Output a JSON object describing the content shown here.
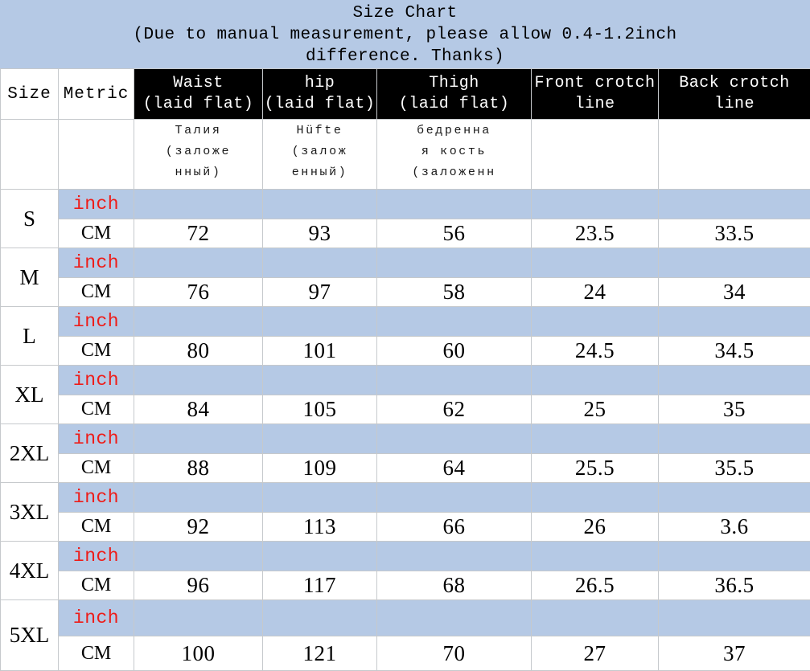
{
  "title": {
    "line1": "Size Chart",
    "line2": "(Due to manual measurement, please allow 0.4-1.2inch",
    "line3": "difference. Thanks)"
  },
  "colors": {
    "banner_blue": "#b5c9e5",
    "stripe_blue": "#b5c9e5",
    "header_black": "#000000",
    "inch_red": "#ee1c18",
    "grid_line": "#c6c9cc"
  },
  "header": {
    "size": "Size",
    "metric": "Metric",
    "waist": {
      "line1": "Waist",
      "line2": "(laid flat)"
    },
    "hip": {
      "line1": "hip",
      "line2": "(laid flat)"
    },
    "thigh": {
      "line1": "Thigh",
      "line2": "(laid flat)"
    },
    "front_crotch": {
      "line1": "Front crotch",
      "line2": "line"
    },
    "back_crotch": {
      "line1": "Back crotch",
      "line2": "line"
    }
  },
  "translations": {
    "waist": {
      "line1": "Талия",
      "line2": "(заложе",
      "line3": "нный)"
    },
    "hip": {
      "line1": "Hüfte",
      "line2": "(залож",
      "line3": "енный)"
    },
    "thigh": {
      "line1": "бедренна",
      "line2": "я кость",
      "line3": "(заложенн"
    }
  },
  "metric_labels": {
    "inch": "inch",
    "cm": "CM"
  },
  "chart_data": {
    "type": "table",
    "title": "Size Chart",
    "columns": [
      "Size",
      "Metric",
      "Waist (laid flat)",
      "hip (laid flat)",
      "Thigh (laid flat)",
      "Front crotch line",
      "Back crotch line"
    ],
    "units": [
      "inch",
      "CM"
    ],
    "rows": [
      {
        "size": "S",
        "inch": {
          "waist": "",
          "hip": "",
          "thigh": "",
          "front_crotch": "",
          "back_crotch": ""
        },
        "cm": {
          "waist": "72",
          "hip": "93",
          "thigh": "56",
          "front_crotch": "23.5",
          "back_crotch": "33.5"
        }
      },
      {
        "size": "M",
        "inch": {
          "waist": "",
          "hip": "",
          "thigh": "",
          "front_crotch": "",
          "back_crotch": ""
        },
        "cm": {
          "waist": "76",
          "hip": "97",
          "thigh": "58",
          "front_crotch": "24",
          "back_crotch": "34"
        }
      },
      {
        "size": "L",
        "inch": {
          "waist": "",
          "hip": "",
          "thigh": "",
          "front_crotch": "",
          "back_crotch": ""
        },
        "cm": {
          "waist": "80",
          "hip": "101",
          "thigh": "60",
          "front_crotch": "24.5",
          "back_crotch": "34.5"
        }
      },
      {
        "size": "XL",
        "inch": {
          "waist": "",
          "hip": "",
          "thigh": "",
          "front_crotch": "",
          "back_crotch": ""
        },
        "cm": {
          "waist": "84",
          "hip": "105",
          "thigh": "62",
          "front_crotch": "25",
          "back_crotch": "35"
        }
      },
      {
        "size": "2XL",
        "inch": {
          "waist": "",
          "hip": "",
          "thigh": "",
          "front_crotch": "",
          "back_crotch": ""
        },
        "cm": {
          "waist": "88",
          "hip": "109",
          "thigh": "64",
          "front_crotch": "25.5",
          "back_crotch": "35.5"
        }
      },
      {
        "size": "3XL",
        "inch": {
          "waist": "",
          "hip": "",
          "thigh": "",
          "front_crotch": "",
          "back_crotch": ""
        },
        "cm": {
          "waist": "92",
          "hip": "113",
          "thigh": "66",
          "front_crotch": "26",
          "back_crotch": "3.6"
        }
      },
      {
        "size": "4XL",
        "inch": {
          "waist": "",
          "hip": "",
          "thigh": "",
          "front_crotch": "",
          "back_crotch": ""
        },
        "cm": {
          "waist": "96",
          "hip": "117",
          "thigh": "68",
          "front_crotch": "26.5",
          "back_crotch": "36.5"
        }
      },
      {
        "size": "5XL",
        "inch": {
          "waist": "",
          "hip": "",
          "thigh": "",
          "front_crotch": "",
          "back_crotch": ""
        },
        "cm": {
          "waist": "100",
          "hip": "121",
          "thigh": "70",
          "front_crotch": "27",
          "back_crotch": "37"
        }
      }
    ]
  }
}
